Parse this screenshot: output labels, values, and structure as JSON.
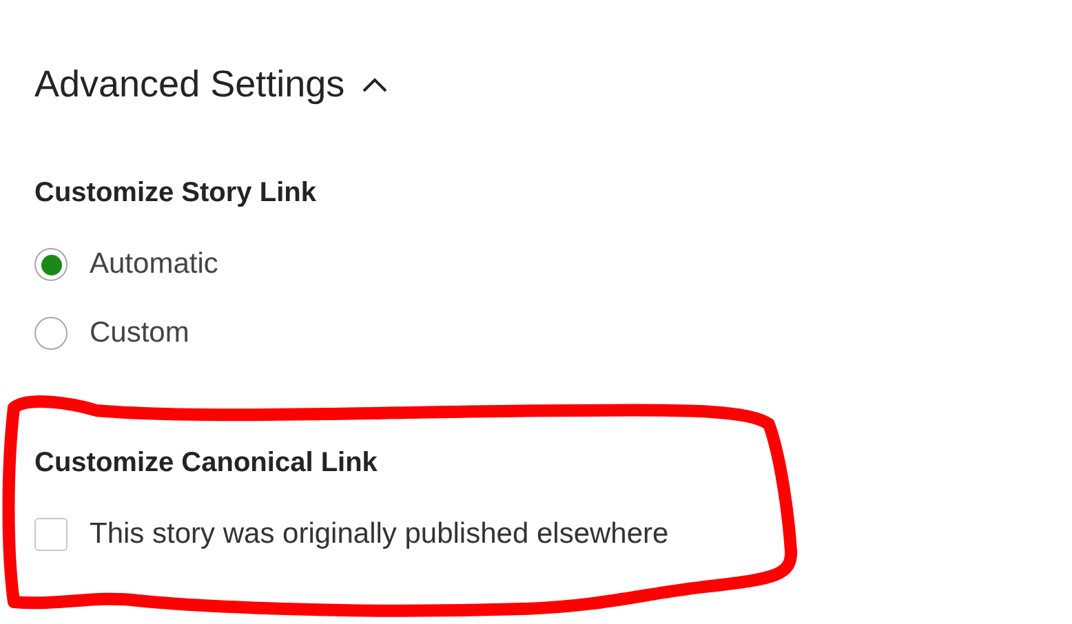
{
  "section": {
    "title": "Advanced Settings",
    "expanded": true
  },
  "story_link": {
    "title": "Customize Story Link",
    "options": [
      {
        "label": "Automatic",
        "selected": true
      },
      {
        "label": "Custom",
        "selected": false
      }
    ]
  },
  "canonical_link": {
    "title": "Customize Canonical Link",
    "checkbox": {
      "label": "This story was originally published elsewhere",
      "checked": false
    }
  },
  "annotation": {
    "kind": "highlight"
  }
}
